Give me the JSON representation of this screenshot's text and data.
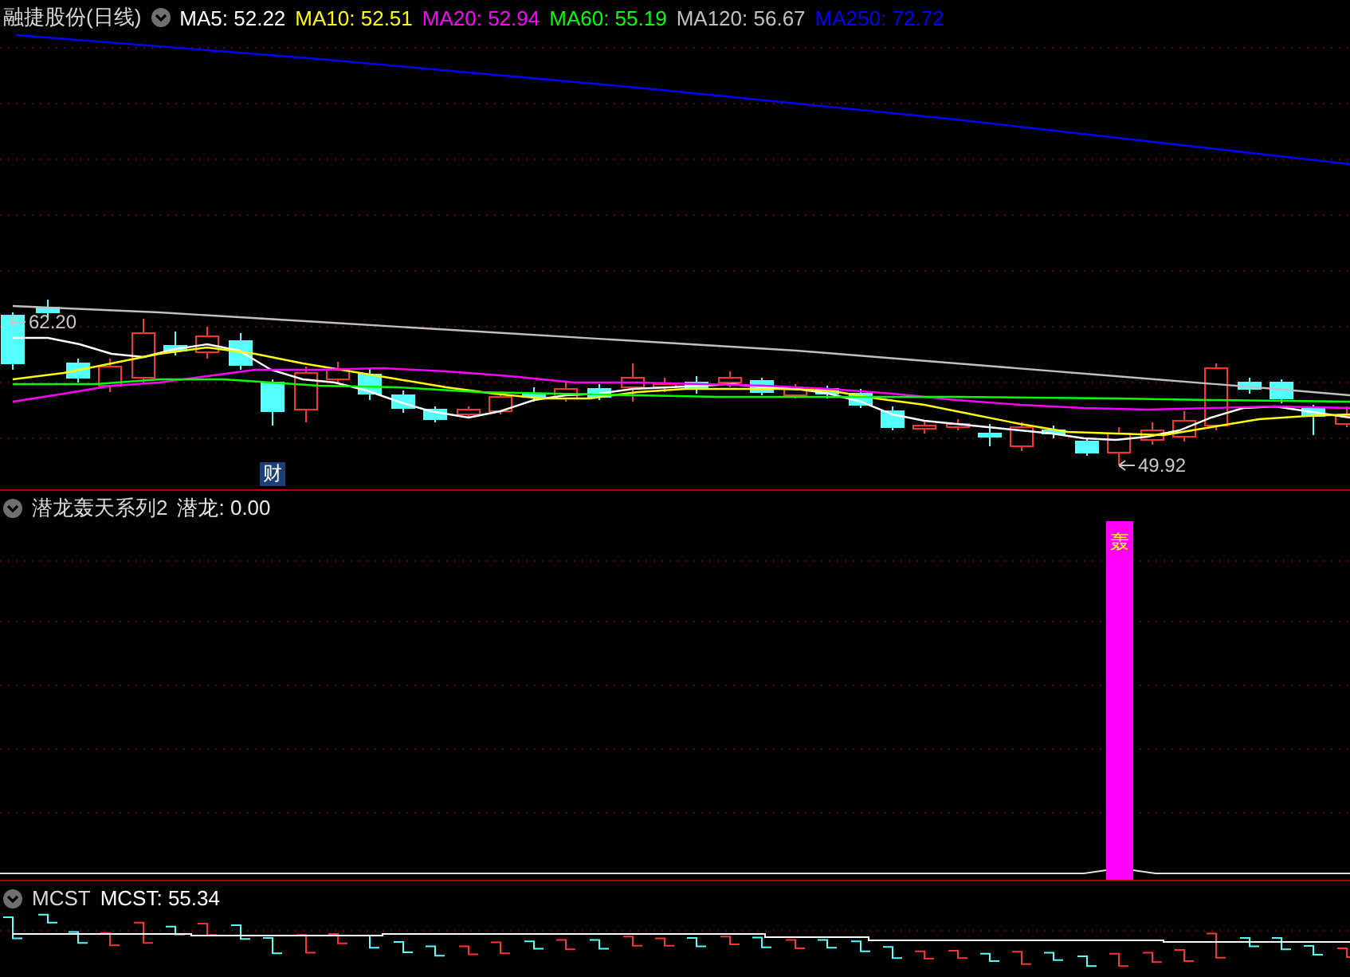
{
  "main_chart": {
    "title": "融捷股份(日线)",
    "legend": [
      {
        "label": "MA5: 52.22",
        "color": "#ffffff"
      },
      {
        "label": "MA10: 52.51",
        "color": "#ffff00"
      },
      {
        "label": "MA20: 52.94",
        "color": "#ff00ff"
      },
      {
        "label": "MA60: 55.19",
        "color": "#00ff00"
      },
      {
        "label": "MA120: 56.67",
        "color": "#c0c0c0"
      },
      {
        "label": "MA250: 72.72",
        "color": "#0000ff"
      }
    ],
    "high_label": "62.20",
    "low_label": "49.92",
    "event_badge": "财"
  },
  "indicator_panel": {
    "title": "潜龙轰天系列2",
    "legend": [
      {
        "label": "潜龙: 0.00",
        "color": "#e8e8e8"
      }
    ],
    "signal_label": "轰"
  },
  "mcst_panel": {
    "title": "MCST",
    "legend": [
      {
        "label": "MCST: 55.34",
        "color": "#ffffff"
      }
    ]
  }
}
